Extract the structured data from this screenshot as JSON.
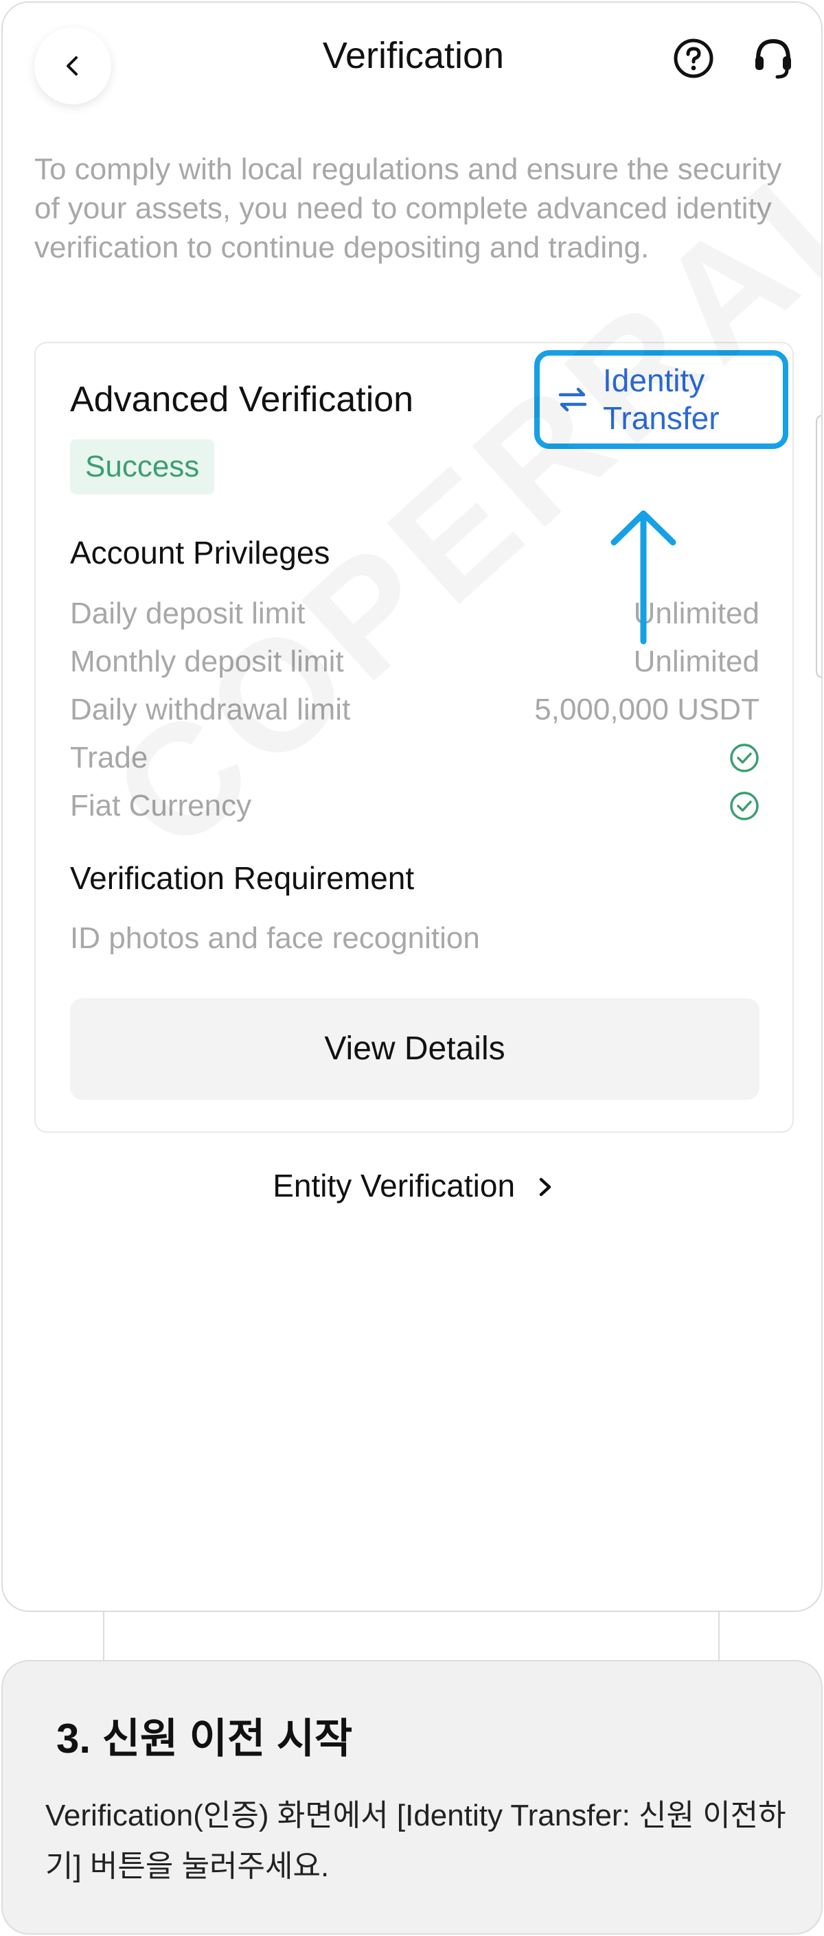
{
  "header": {
    "title": "Verification",
    "back_icon": "chevron-left-icon",
    "help_icon": "question-circle-icon",
    "support_icon": "headset-icon"
  },
  "intro_text": "To comply with local regulations and ensure the security of your assets, you need to complete advanced identity verification to continue depositing and trading.",
  "card": {
    "title": "Advanced Verification",
    "status": "Success",
    "transfer_button": {
      "icon": "swap-arrows-icon",
      "line1": "Identity",
      "line2": "Transfer"
    },
    "privileges_heading": "Account Privileges",
    "privileges": [
      {
        "label": "Daily deposit limit",
        "value": "Unlimited"
      },
      {
        "label": "Monthly deposit limit",
        "value": "Unlimited"
      },
      {
        "label": "Daily withdrawal limit",
        "value": "5,000,000 USDT"
      },
      {
        "label": "Trade",
        "value": "check-circle-icon"
      },
      {
        "label": "Fiat Currency",
        "value": "check-circle-icon"
      }
    ],
    "requirement_heading": "Verification Requirement",
    "requirement_text": "ID photos and face recognition",
    "details_button": "View Details"
  },
  "entity_link": "Entity Verification",
  "watermark": "COPERRAL",
  "caption": {
    "title": "3. 신원 이전 시작",
    "body": "Verification(인증) 화면에서 [Identity Transfer: 신원 이전하기] 버튼을 눌러주세요."
  },
  "colors": {
    "highlight": "#16a0e6",
    "link_blue": "#2a6ad8",
    "success_green": "#3c9e73",
    "muted_text": "#a8a8a8"
  }
}
